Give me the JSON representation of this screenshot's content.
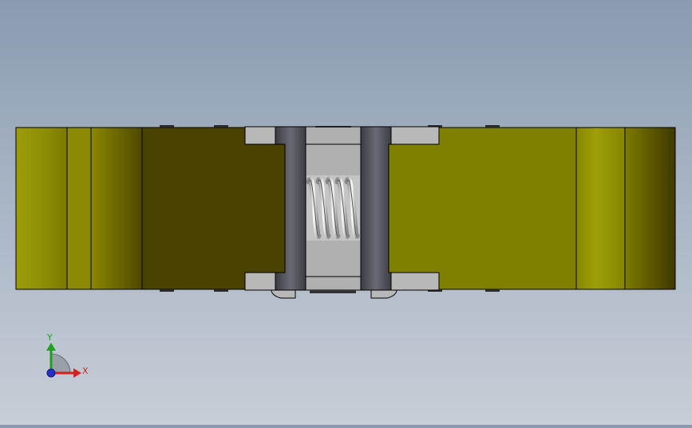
{
  "viewport": {
    "background_top": "#8a9bb0",
    "background_bottom": "#c7ced7"
  },
  "model": {
    "part_colors": {
      "olive_bright": "#9a9a06",
      "olive": "#808000",
      "olive_dark": "#4a4200",
      "steel_light": "#b8b8b8",
      "steel_dark": "#5e5e66",
      "outline": "#000000"
    }
  },
  "triad": {
    "x_label": "X",
    "y_label": "Y",
    "x_color": "#d42020",
    "y_color": "#1aa31a",
    "z_color": "#2430c8"
  }
}
